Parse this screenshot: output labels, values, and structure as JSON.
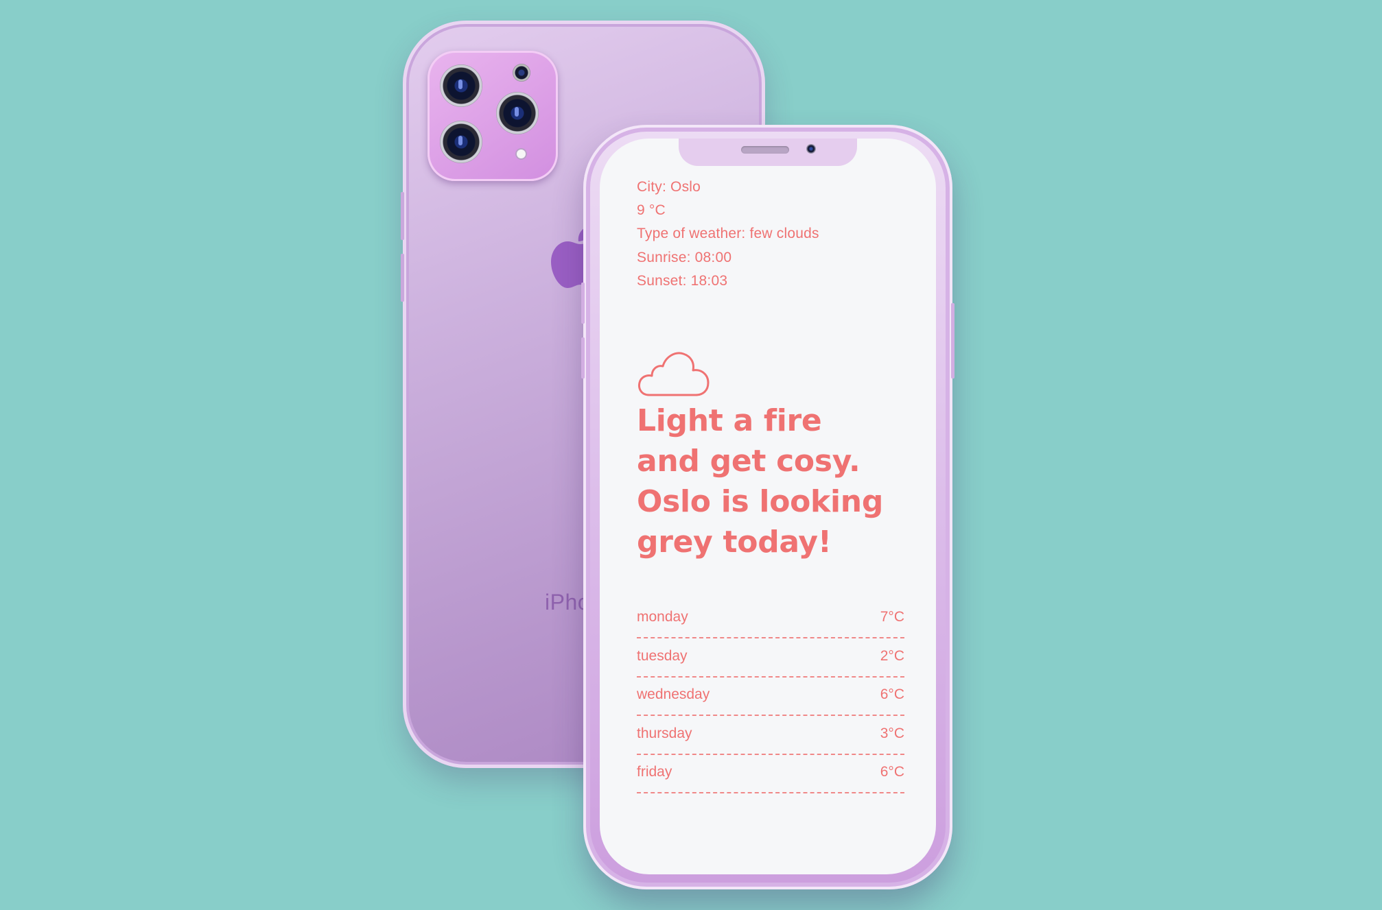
{
  "colors": {
    "background": "#88cec9",
    "accent_text": "#ef7272",
    "screen": "#f6f7f9",
    "phone_body": "#cdb2de"
  },
  "back_phone": {
    "brand_text": "iPhone"
  },
  "weather": {
    "city_line": "City: Oslo",
    "temp_line": "9 °C",
    "type_line": "Type of weather: few clouds",
    "sunrise_line": "Sunrise: 08:00",
    "sunset_line": "Sunset: 18:03",
    "icon": "cloud-icon",
    "headline": [
      "Light a fire",
      "and get cosy.",
      "Oslo is looking",
      "grey today!"
    ]
  },
  "forecast": [
    {
      "day": "monday",
      "temp": "7°C"
    },
    {
      "day": "tuesday",
      "temp": "2°C"
    },
    {
      "day": "wednesday",
      "temp": "6°C"
    },
    {
      "day": "thursday",
      "temp": "3°C"
    },
    {
      "day": "friday",
      "temp": "6°C"
    }
  ]
}
